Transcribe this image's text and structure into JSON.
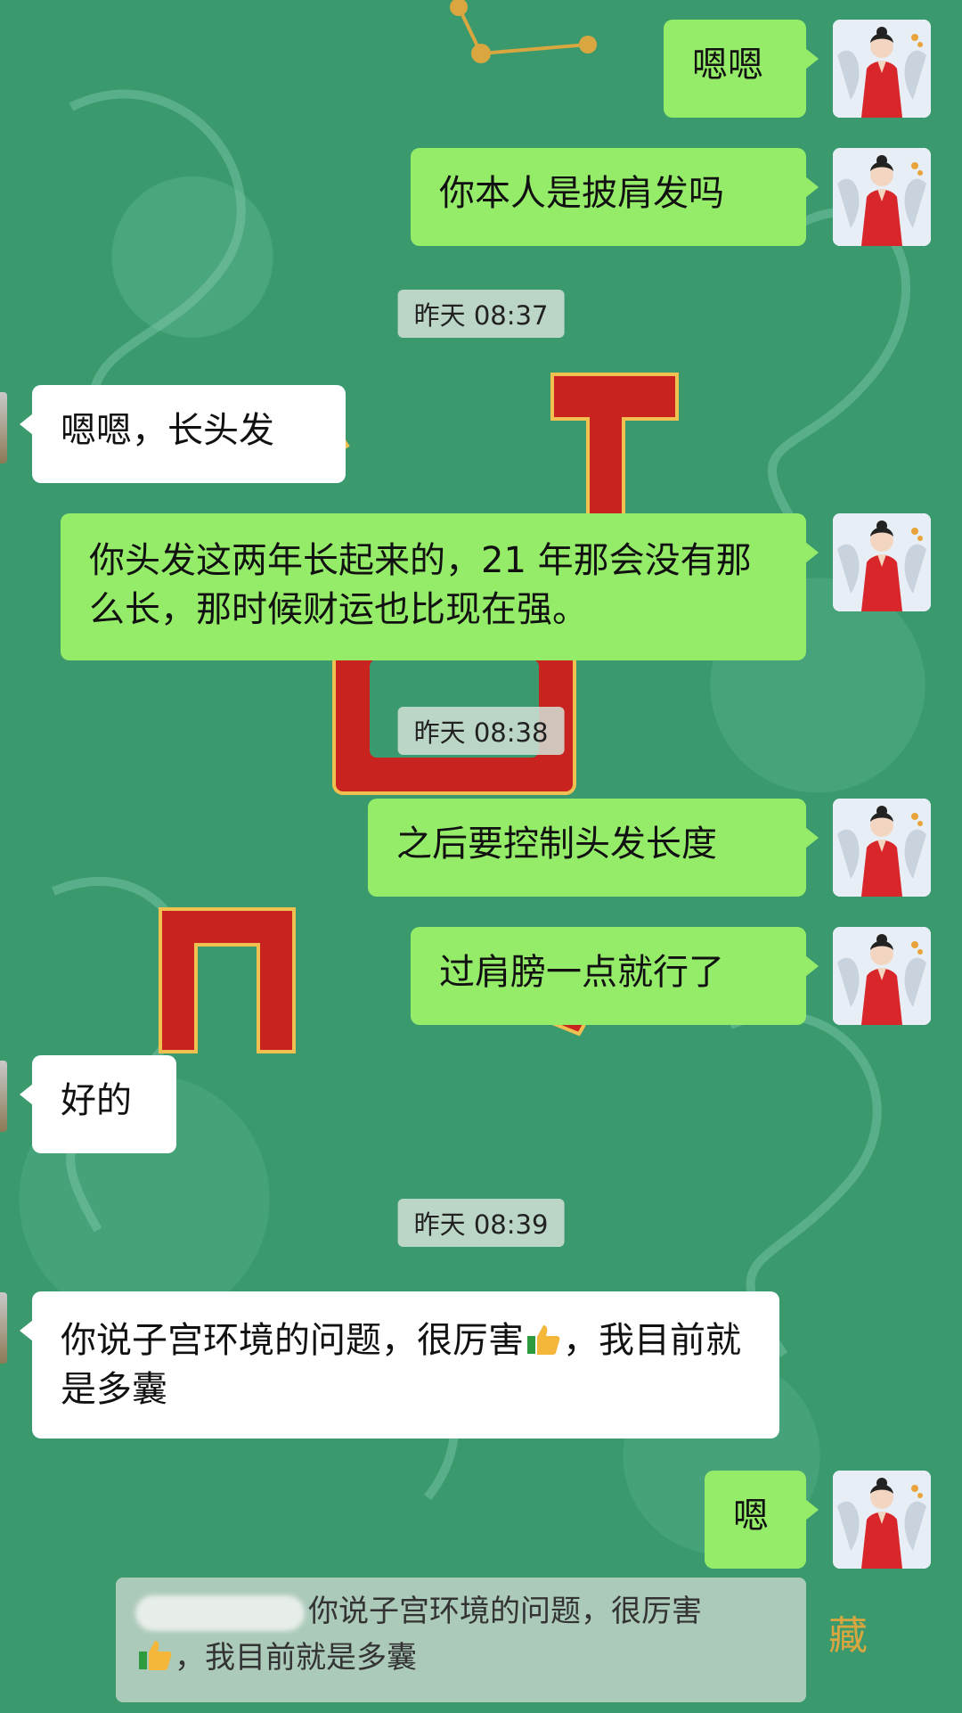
{
  "chat": {
    "timestamps": [
      "昨天 08:37",
      "昨天 08:38",
      "昨天 08:39"
    ],
    "messages": [
      {
        "side": "right",
        "text": "嗯嗯"
      },
      {
        "side": "right",
        "text": "你本人是披肩发吗"
      },
      {
        "side": "left",
        "text": "嗯嗯，长头发"
      },
      {
        "side": "right",
        "text": "你头发这两年长起来的，21 年那会没有那么长，那时候财运也比现在强。"
      },
      {
        "side": "right",
        "text": "之后要控制头发长度"
      },
      {
        "side": "right",
        "text": "过肩膀一点就行了"
      },
      {
        "side": "left",
        "text": "好的"
      },
      {
        "side": "left",
        "text_before": "你说子宫环境的问题，很厉害",
        "text_after": "，我目前就是多囊"
      },
      {
        "side": "right",
        "text": "嗯"
      }
    ],
    "quote": {
      "text_before": "你说子宫环境的问题，很厉害",
      "text_after": "，我目前就是多囊"
    },
    "emoji": "thumbs-up"
  }
}
